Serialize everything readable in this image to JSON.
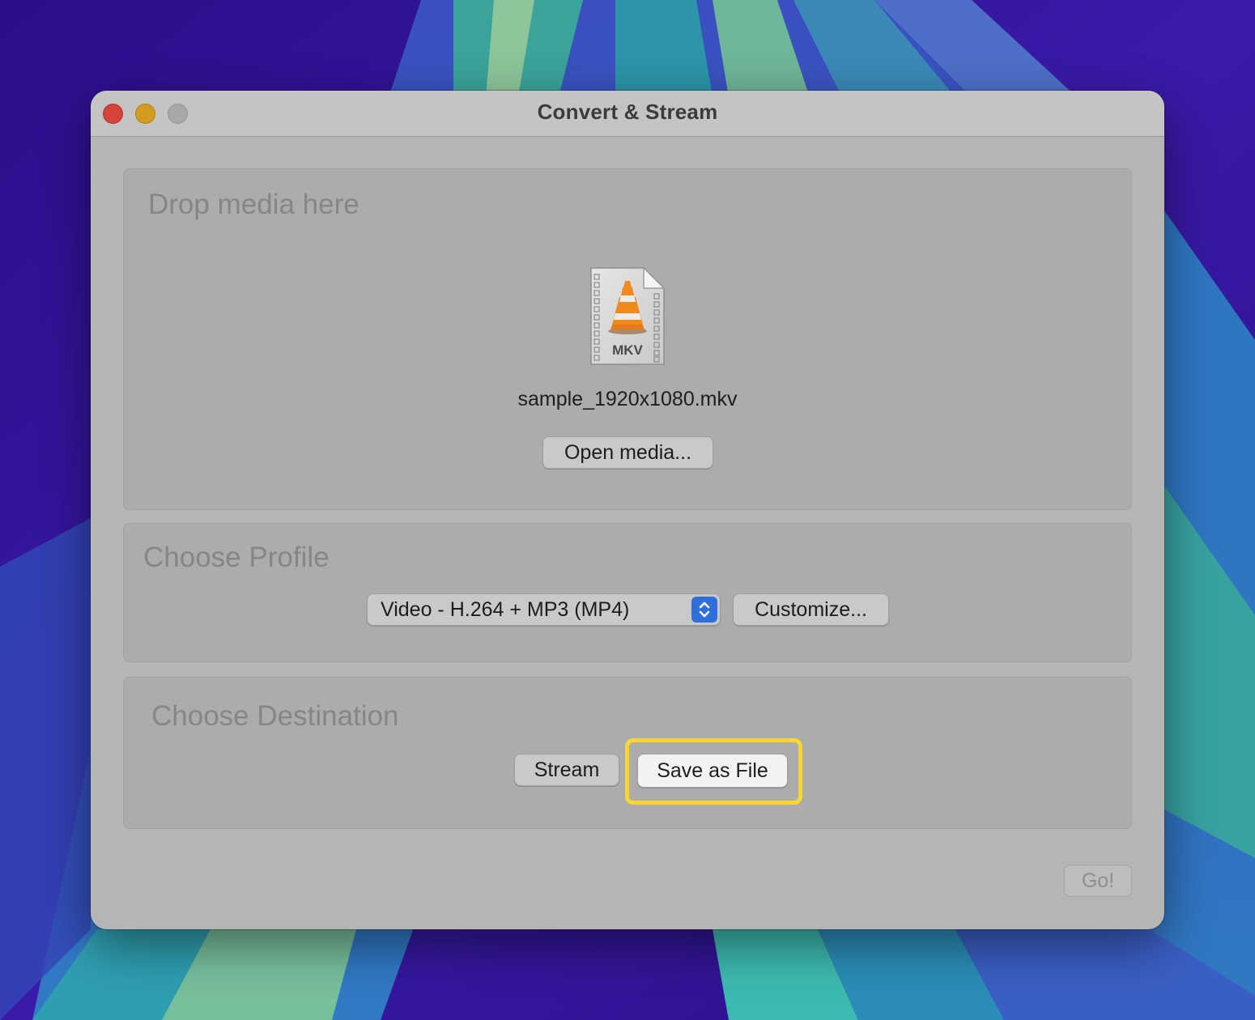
{
  "window": {
    "title": "Convert & Stream",
    "controls": [
      "close",
      "minimize",
      "zoom"
    ]
  },
  "source": {
    "label": "Drop media here",
    "file_icon": "vlc-mkv-file-icon",
    "file_type_badge": "MKV",
    "file_name": "sample_1920x1080.mkv",
    "open_button": "Open media..."
  },
  "profile": {
    "label": "Choose Profile",
    "selected": "Video - H.264 + MP3 (MP4)",
    "customize_button": "Customize..."
  },
  "destination": {
    "label": "Choose Destination",
    "stream_button": "Stream",
    "save_button": "Save as File",
    "highlight_color": "#f7d631"
  },
  "actions": {
    "go_button": "Go!"
  },
  "colors": {
    "vlc_orange": "#f08a1c",
    "stepper_blue": "#2f6fd9"
  }
}
